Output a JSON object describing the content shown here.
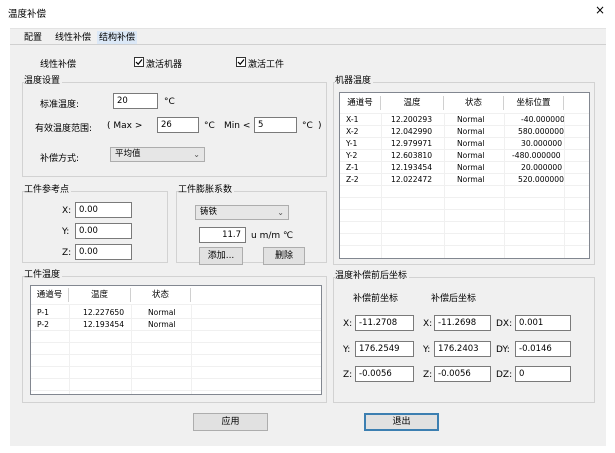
{
  "window": {
    "title": "温度补偿",
    "close_label": "×"
  },
  "tabs": [
    {
      "label": "配置"
    },
    {
      "label": "线性补偿"
    },
    {
      "label": "结构补偿"
    }
  ],
  "top": {
    "linear_label": "线性补偿",
    "activate_machine_label": "激活机器",
    "activate_workpiece_label": "激活工件",
    "activate_machine_checked": true,
    "activate_workpiece_checked": true
  },
  "temp_settings": {
    "group_title": "温度设置",
    "std_temp_label": "标准温度:",
    "std_temp_value": "20",
    "std_temp_unit": "°C",
    "valid_range_label": "有效温度范围:",
    "max_label": "( Max >",
    "max_value": "26",
    "max_unit": "°C",
    "min_label": "Min <",
    "min_value": "5",
    "min_unit": "°C",
    "close_paren": ")",
    "method_label": "补偿方式:",
    "method_value": "平均值"
  },
  "workpiece_ref": {
    "group_title": "工件参考点",
    "x_label": "X:",
    "x_value": "0.00",
    "y_label": "Y:",
    "y_value": "0.00",
    "z_label": "Z:",
    "z_value": "0.00"
  },
  "expansion": {
    "group_title": "工件膨胀系数",
    "material_value": "铸铁",
    "coef_value": "11.7",
    "coef_unit": "u m/m ℃",
    "add_label": "添加...",
    "delete_label": "删除"
  },
  "machine_temp": {
    "group_title": "机器温度",
    "columns": [
      "通道号",
      "温度",
      "状态",
      "坐标位置"
    ],
    "rows": [
      [
        "X-1",
        "12.200293",
        "Normal",
        "-40.000000"
      ],
      [
        "X-2",
        "12.042990",
        "Normal",
        "580.000000"
      ],
      [
        "Y-1",
        "12.979971",
        "Normal",
        "30.000000"
      ],
      [
        "Y-2",
        "12.603810",
        "Normal",
        "-480.000000"
      ],
      [
        "Z-1",
        "12.193454",
        "Normal",
        "20.000000"
      ],
      [
        "Z-2",
        "12.022472",
        "Normal",
        "520.000000"
      ]
    ]
  },
  "workpiece_temp": {
    "group_title": "工件温度",
    "columns": [
      "通道号",
      "温度",
      "状态"
    ],
    "rows": [
      [
        "P-1",
        "12.227650",
        "Normal"
      ],
      [
        "P-2",
        "12.193454",
        "Normal"
      ]
    ]
  },
  "coords": {
    "group_title": "温度补偿前后坐标",
    "before_label": "补偿前坐标",
    "after_label": "补偿后坐标",
    "x_label": "X:",
    "x_before": "-11.2708",
    "x_after": "-11.2698",
    "y_label": "Y:",
    "y_before": "176.2549",
    "y_after": "176.2403",
    "z_label": "Z:",
    "z_before": "-0.0056",
    "z_after": "-0.0056",
    "dx_label": "DX:",
    "dx_value": "0.001",
    "dy_label": "DY:",
    "dy_value": "-0.0146",
    "dz_label": "DZ:",
    "dz_value": "0"
  },
  "footer": {
    "apply_label": "应用",
    "exit_label": "退出"
  }
}
